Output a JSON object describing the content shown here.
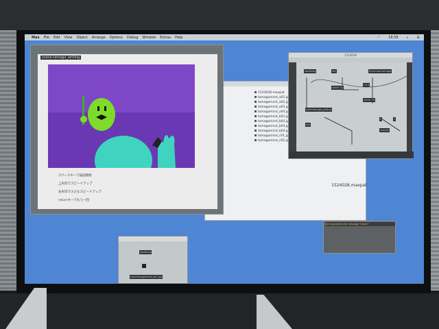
{
  "menubar": {
    "app": "Max",
    "items": [
      "File",
      "Edit",
      "View",
      "Object",
      "Arrange",
      "Options",
      "Debug",
      "Window",
      "Extras",
      "Help"
    ],
    "clock": "16:55"
  },
  "presentation": {
    "label": "scene tamago_writing",
    "lines": [
      "スペースキーで描画開始",
      "上矢印でスピードアップ",
      "左矢印で小さなスピードアップ",
      "returnキーでもう一回"
    ],
    "colors": {
      "sky": "#7d47c8",
      "ground": "#6a38b2",
      "bird": "#7ddc2a",
      "body": "#3fd3c0"
    }
  },
  "files": {
    "items": [
      "1524028.maxpat",
      "tamagomind_a01.jpg",
      "tamagomind_a02.jpg",
      "tamagomind_a03.jpg",
      "tamagomind_a04.jpg",
      "tamagomind_b01.jpg",
      "tamagomind_b02.jpg",
      "tamagomind_b03.jpg",
      "tamagomind_b04.jpg",
      "tamagomind_c01.jpg",
      "tamagomind_c02.jpg"
    ],
    "preview_title": "1524028.maxpat"
  },
  "patcher": {
    "title": "1524028",
    "objects": [
      "loadbang",
      "key",
      "jit.window tamago",
      "select 32",
      "t b b",
      "metro 33",
      "send tamago_writing",
      "pak",
      "0",
      "1",
      "counter"
    ]
  },
  "console": {
    "message": "bad arguments for message \"value\""
  },
  "small_window": {
    "objects": [
      "loadbang",
      "read tamagomind_a01.jpg"
    ]
  }
}
